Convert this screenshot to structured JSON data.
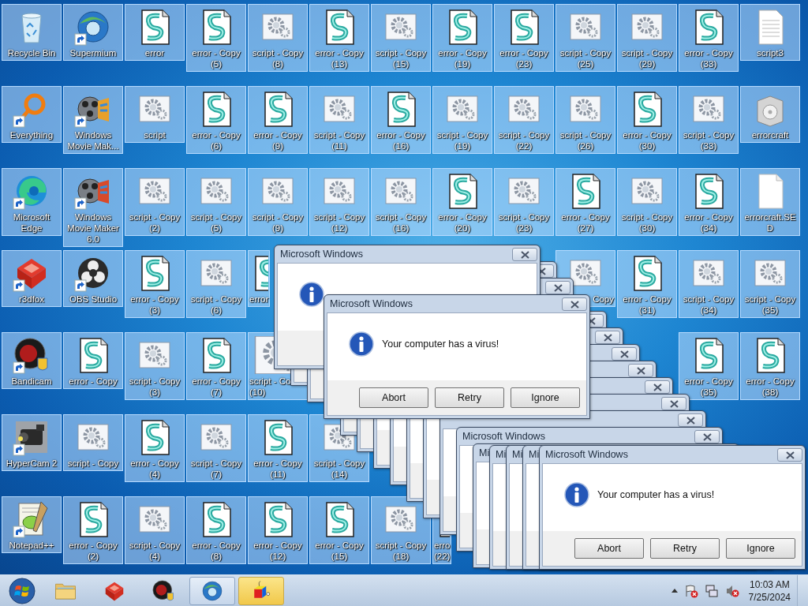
{
  "desktop": {
    "rows": [
      [
        {
          "kind": "recycle",
          "label": "Recycle Bin",
          "shortcut": false,
          "selected": true
        },
        {
          "kind": "globe",
          "label": "Supermium",
          "shortcut": true,
          "selected": true
        },
        {
          "kind": "scroll",
          "label": "error",
          "shortcut": false,
          "selected": true
        },
        {
          "kind": "scroll",
          "label": "error - Copy (5)",
          "shortcut": false,
          "selected": true
        },
        {
          "kind": "gear",
          "label": "script - Copy (8)",
          "shortcut": false,
          "selected": true
        },
        {
          "kind": "scroll",
          "label": "error - Copy (13)",
          "shortcut": false,
          "selected": true
        },
        {
          "kind": "gear",
          "label": "script - Copy (15)",
          "shortcut": false,
          "selected": true
        },
        {
          "kind": "scroll",
          "label": "error - Copy (19)",
          "shortcut": false,
          "selected": true
        },
        {
          "kind": "scroll",
          "label": "error - Copy (23)",
          "shortcut": false,
          "selected": true
        },
        {
          "kind": "gear",
          "label": "script - Copy (25)",
          "shortcut": false,
          "selected": true
        },
        {
          "kind": "gear",
          "label": "script - Copy (29)",
          "shortcut": false,
          "selected": true
        },
        {
          "kind": "scroll",
          "label": "error - Copy (33)",
          "shortcut": false,
          "selected": true
        },
        {
          "kind": "page",
          "label": "script3",
          "shortcut": false,
          "selected": true
        }
      ],
      [
        {
          "kind": "ring",
          "label": "Everything",
          "shortcut": true,
          "selected": true
        },
        {
          "kind": "film",
          "label": "Windows Movie Mak...",
          "shortcut": true,
          "selected": true
        },
        {
          "kind": "gear",
          "label": "script",
          "shortcut": false,
          "selected": true
        },
        {
          "kind": "scroll",
          "label": "error - Copy (6)",
          "shortcut": false,
          "selected": true
        },
        {
          "kind": "scroll",
          "label": "error - Copy (9)",
          "shortcut": false,
          "selected": true
        },
        {
          "kind": "gear",
          "label": "script - Copy (11)",
          "shortcut": false,
          "selected": true
        },
        {
          "kind": "scroll",
          "label": "error - Copy (16)",
          "shortcut": false,
          "selected": true
        },
        {
          "kind": "gear",
          "label": "script - Copy (19)",
          "shortcut": false,
          "selected": true
        },
        {
          "kind": "gear",
          "label": "script - Copy (22)",
          "shortcut": false,
          "selected": true
        },
        {
          "kind": "gear",
          "label": "script - Copy (26)",
          "shortcut": false,
          "selected": true
        },
        {
          "kind": "scroll",
          "label": "error - Copy (30)",
          "shortcut": false,
          "selected": true
        },
        {
          "kind": "gear",
          "label": "script - Copy (33)",
          "shortcut": false,
          "selected": true
        },
        {
          "kind": "installer",
          "label": "errorcraft",
          "shortcut": false,
          "selected": true
        }
      ],
      [
        {
          "kind": "edge",
          "label": "Microsoft Edge",
          "shortcut": true,
          "selected": true
        },
        {
          "kind": "film2",
          "label": "Windows Movie Maker 6.0",
          "shortcut": true,
          "selected": true
        },
        {
          "kind": "gear",
          "label": "script - Copy (2)",
          "shortcut": false,
          "selected": true
        },
        {
          "kind": "gear",
          "label": "script - Copy (5)",
          "shortcut": false,
          "selected": true
        },
        {
          "kind": "gear",
          "label": "script - Copy (9)",
          "shortcut": false,
          "selected": true
        },
        {
          "kind": "gear",
          "label": "script - Copy (12)",
          "shortcut": false,
          "selected": true
        },
        {
          "kind": "gear",
          "label": "script - Copy (16)",
          "shortcut": false,
          "selected": true
        },
        {
          "kind": "scroll",
          "label": "error - Copy (20)",
          "shortcut": false,
          "selected": true
        },
        {
          "kind": "gear",
          "label": "script - Copy (23)",
          "shortcut": false,
          "selected": true
        },
        {
          "kind": "scroll",
          "label": "error - Copy (27)",
          "shortcut": false,
          "selected": true
        },
        {
          "kind": "gear",
          "label": "script - Copy (30)",
          "shortcut": false,
          "selected": true
        },
        {
          "kind": "scroll",
          "label": "error - Copy (34)",
          "shortcut": false,
          "selected": true
        },
        {
          "kind": "blank",
          "label": "errorcraft.SED",
          "shortcut": false,
          "selected": true
        }
      ],
      [
        {
          "kind": "foxcube",
          "label": "r3dfox",
          "shortcut": true,
          "selected": true
        },
        {
          "kind": "obs",
          "label": "OBS Studio",
          "shortcut": true,
          "selected": true
        },
        {
          "kind": "scroll",
          "label": "error - Copy (3)",
          "shortcut": false,
          "selected": true
        },
        {
          "kind": "gear",
          "label": "script - Copy (6)",
          "shortcut": false,
          "selected": true
        },
        {
          "kind": "scroll",
          "label": "error",
          "shortcut": false,
          "selected": true,
          "clipped_right": true
        },
        null,
        null,
        null,
        null,
        {
          "kind": "gear",
          "label": "Copy",
          "shortcut": false,
          "selected": true,
          "clipped_left": true
        },
        {
          "kind": "scroll",
          "label": "error - Copy (31)",
          "shortcut": false,
          "selected": true
        },
        {
          "kind": "gear",
          "label": "script - Copy (34)",
          "shortcut": false,
          "selected": true
        },
        {
          "kind": "gear",
          "label": "script - Copy (35)",
          "shortcut": false,
          "selected": true
        }
      ],
      [
        {
          "kind": "bandicam",
          "label": "Bandicam",
          "shortcut": true,
          "selected": true
        },
        {
          "kind": "scroll",
          "label": "error - Copy",
          "shortcut": false,
          "selected": true
        },
        {
          "kind": "gear",
          "label": "script - Copy (3)",
          "shortcut": false,
          "selected": true
        },
        {
          "kind": "scroll",
          "label": "error - Copy (7)",
          "shortcut": false,
          "selected": true
        },
        {
          "kind": "gear",
          "label": "script - Co (10)",
          "shortcut": false,
          "selected": true,
          "clipped_right": true
        },
        null,
        null,
        null,
        null,
        null,
        null,
        {
          "kind": "scroll",
          "label": "error - Copy (35)",
          "shortcut": false,
          "selected": true
        },
        {
          "kind": "scroll",
          "label": "error - Copy (38)",
          "shortcut": false,
          "selected": true
        }
      ],
      [
        {
          "kind": "camera",
          "label": "HyperCam 2",
          "shortcut": true,
          "selected": true
        },
        {
          "kind": "gear",
          "label": "script - Copy",
          "shortcut": false,
          "selected": true
        },
        {
          "kind": "scroll",
          "label": "error - Copy (4)",
          "shortcut": false,
          "selected": true
        },
        {
          "kind": "gear",
          "label": "script - Copy (7)",
          "shortcut": false,
          "selected": true
        },
        {
          "kind": "scroll",
          "label": "error - Copy (11)",
          "shortcut": false,
          "selected": true
        },
        {
          "kind": "gear",
          "label": "script - Copy (14)",
          "shortcut": false,
          "selected": true
        }
      ],
      [
        {
          "kind": "notepad",
          "label": "Notepad++",
          "shortcut": true,
          "selected": true
        },
        {
          "kind": "scroll",
          "label": "error - Copy (2)",
          "shortcut": false,
          "selected": true
        },
        {
          "kind": "gear",
          "label": "script - Copy (4)",
          "shortcut": false,
          "selected": true
        },
        {
          "kind": "scroll",
          "label": "error - Copy (8)",
          "shortcut": false,
          "selected": true
        },
        {
          "kind": "scroll",
          "label": "error - Copy (12)",
          "shortcut": false,
          "selected": true
        },
        {
          "kind": "scroll",
          "label": "error - Copy (15)",
          "shortcut": false,
          "selected": true
        },
        {
          "kind": "gear",
          "label": "script - Copy (18)",
          "shortcut": false,
          "selected": true
        },
        {
          "kind": "scroll",
          "label": "erro\n(22)",
          "shortcut": false,
          "selected": true,
          "clipped_right": true
        }
      ]
    ]
  },
  "dialogs": [
    {
      "kind": "info",
      "title": "Microsoft Windows"
    },
    {
      "kind": "plain"
    },
    {
      "kind": "plain"
    },
    {
      "kind": "info",
      "title": "Microsoft Windows",
      "message": "Your computer has a virus!",
      "buttons": [
        "Abort",
        "Retry",
        "Ignore"
      ]
    },
    {
      "kind": "plain"
    },
    {
      "kind": "plain"
    },
    {
      "kind": "plain"
    },
    {
      "kind": "plain"
    },
    {
      "kind": "plain"
    },
    {
      "kind": "plain"
    },
    {
      "kind": "plain"
    },
    {
      "kind": "plain",
      "title": "Microsoft Windows"
    },
    {
      "kind": "stub",
      "title": "Mi"
    },
    {
      "kind": "stub",
      "title": "Mi"
    },
    {
      "kind": "stub",
      "title": "Mi"
    },
    {
      "kind": "stub",
      "title": "Mi"
    },
    {
      "kind": "info",
      "title": "Microsoft Windows",
      "message": "Your computer has a virus!",
      "buttons": [
        "Abort",
        "Retry",
        "Ignore"
      ]
    }
  ],
  "taskbar": {
    "buttons": [
      {
        "kind": "folder",
        "pressed": false,
        "flashing": false
      },
      {
        "kind": "foxcube",
        "pressed": false,
        "flashing": false
      },
      {
        "kind": "bandicam",
        "pressed": false,
        "flashing": false
      },
      {
        "kind": "globe",
        "pressed": true,
        "flashing": false
      },
      {
        "kind": "cube",
        "pressed": false,
        "flashing": true
      }
    ],
    "clock": {
      "time": "10:03 AM",
      "date": "7/25/2024"
    }
  }
}
